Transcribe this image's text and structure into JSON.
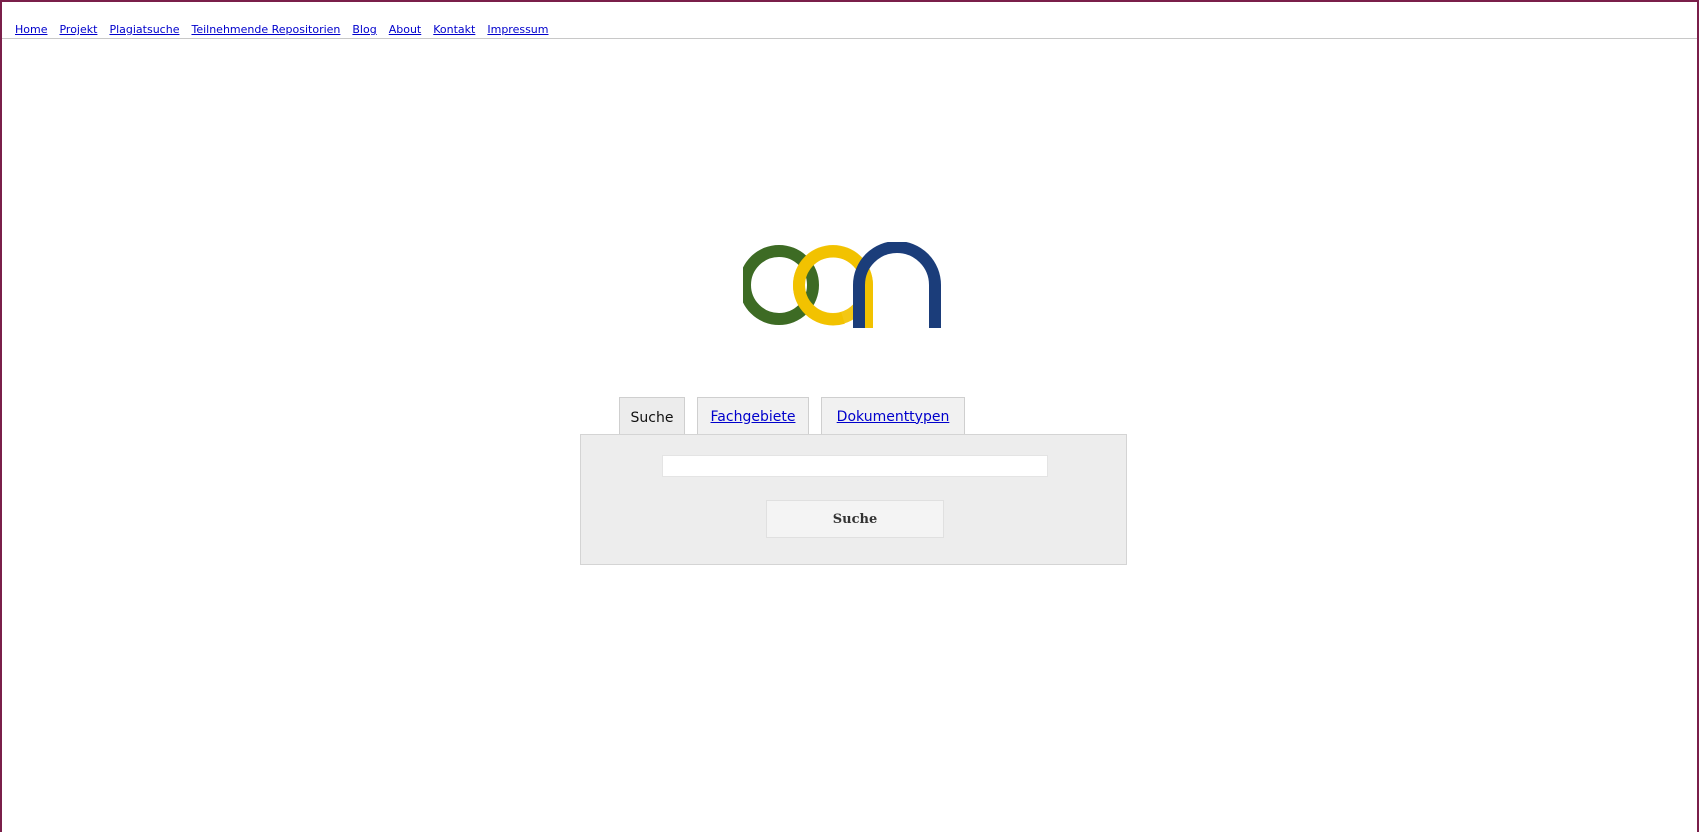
{
  "nav": {
    "items": [
      {
        "label": "Home"
      },
      {
        "label": "Projekt"
      },
      {
        "label": "Plagiatsuche"
      },
      {
        "label": "Teilnehmende Repositorien"
      },
      {
        "label": "Blog"
      },
      {
        "label": "About"
      },
      {
        "label": "Kontakt"
      },
      {
        "label": "Impressum"
      }
    ]
  },
  "logo": {
    "icon": "oan-logo",
    "colors": {
      "o": "#3d6b24",
      "a": "#f2c200",
      "n": "#1b3d7a"
    }
  },
  "tabs": [
    {
      "label": "Suche",
      "active": true
    },
    {
      "label": "Fachgebiete",
      "active": false
    },
    {
      "label": "Dokumenttypen",
      "active": false
    }
  ],
  "search": {
    "value": "",
    "placeholder": "",
    "button_label": "Suche"
  },
  "colors": {
    "frame_border": "#7a1f4a",
    "link": "#0000cc",
    "panel_bg": "#ededed"
  }
}
